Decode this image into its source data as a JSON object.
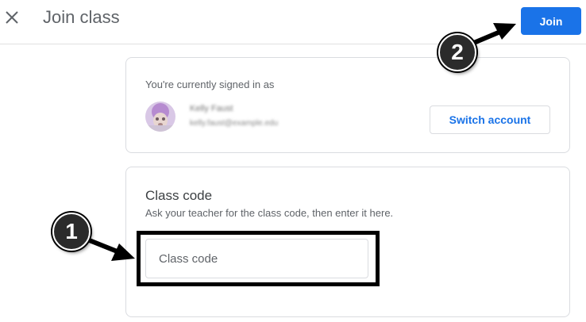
{
  "header": {
    "title": "Join class",
    "join_label": "Join"
  },
  "account": {
    "signed_in_label": "You're currently signed in as",
    "name": "Kelly Faust",
    "email": "kelly.faust@example.edu",
    "switch_label": "Switch account"
  },
  "class_code": {
    "title": "Class code",
    "help": "Ask your teacher for the class code, then enter it here.",
    "placeholder": "Class code",
    "value": ""
  },
  "annotations": {
    "step1": "1",
    "step2": "2"
  },
  "colors": {
    "accent": "#1a73e8",
    "border": "#dadce0",
    "text_secondary": "#5f6368"
  },
  "icons": {
    "close": "close-icon",
    "avatar": "user-avatar"
  }
}
